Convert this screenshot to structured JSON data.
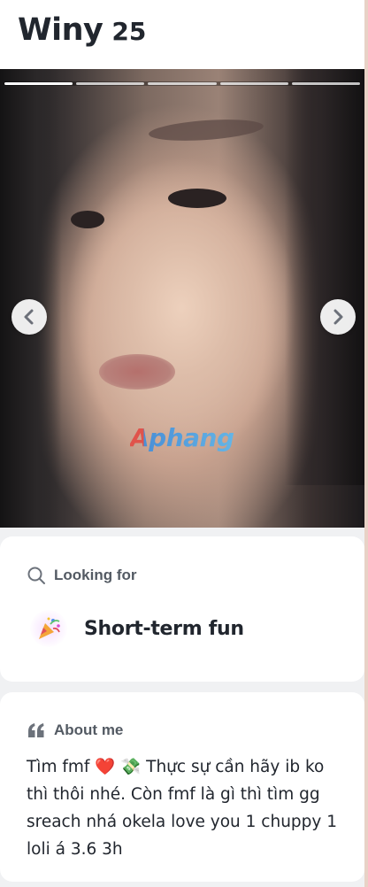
{
  "profile": {
    "name": "Winy",
    "age": "25"
  },
  "photo": {
    "count": 5,
    "current_index": 1,
    "watermark": "Aphang",
    "prev_icon": "chevron-left-icon",
    "next_icon": "chevron-right-icon"
  },
  "looking_for": {
    "title": "Looking for",
    "icon": "search-icon",
    "goal_icon": "party-popper-icon",
    "goal": "Short-term fun"
  },
  "about": {
    "title": "About me",
    "icon": "quote-icon",
    "text_prefix": "Tìm fmf ",
    "text_suffix": " Thực sự cần hãy ib ko thì thôi nhé. Còn fmf là gì thì tìm gg sreach nhá okela love you 1 chuppy 1 loli á 3.6 3h",
    "emoji_heart": "❤️",
    "emoji_money": "💸"
  },
  "colors": {
    "text": "#21262e",
    "muted": "#535a63",
    "background": "#f0f1f3",
    "card": "#ffffff"
  }
}
